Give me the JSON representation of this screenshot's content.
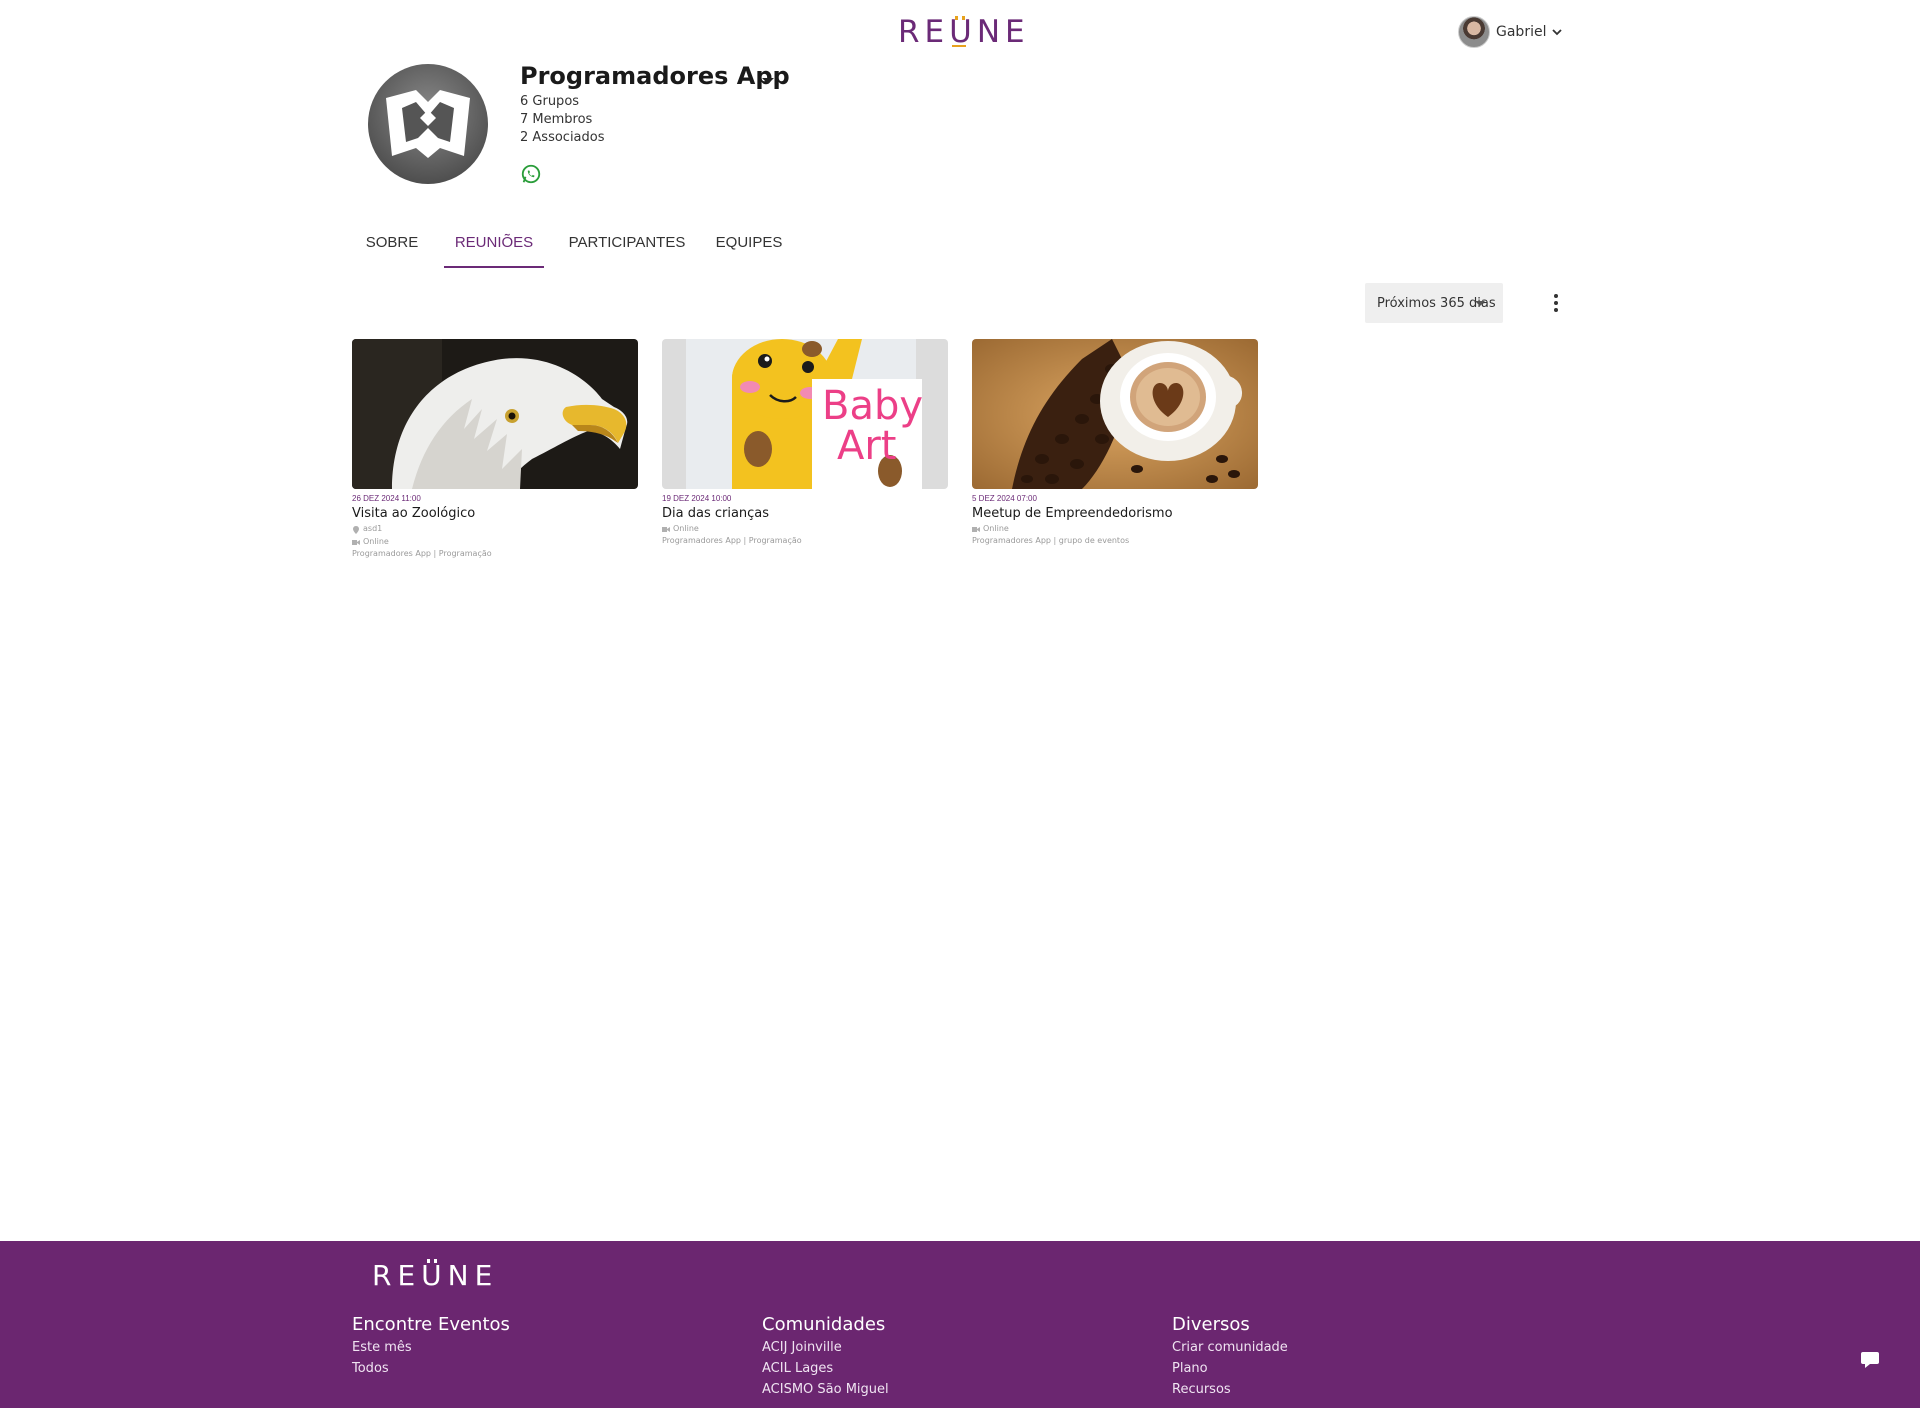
{
  "header": {
    "logo_text": "REUNE",
    "user_name": "Gabriel"
  },
  "community": {
    "name": "Programadores App",
    "stats": [
      "6 Grupos",
      "7 Membros",
      "2 Associados"
    ]
  },
  "tabs": [
    {
      "label": "SOBRE",
      "active": false
    },
    {
      "label": "REUNIÕES",
      "active": true
    },
    {
      "label": "PARTICIPANTES",
      "active": false
    },
    {
      "label": "EQUIPES",
      "active": false
    }
  ],
  "filter": {
    "selected": "Próximos 365 dias"
  },
  "events": [
    {
      "image": "eagle",
      "date": "26 DEZ 2024 11:00",
      "title": "Visita ao Zoológico",
      "location": "asd1",
      "mode": "Online",
      "group": "Programadores App | Programação"
    },
    {
      "image": "giraffe-baby-art",
      "image_text_1": "Baby",
      "image_text_2": "Art",
      "date": "19 DEZ 2024 10:00",
      "title": "Dia das crianças",
      "mode": "Online",
      "group": "Programadores App | Programação"
    },
    {
      "image": "coffee",
      "date": "5 DEZ 2024 07:00",
      "title": "Meetup de Empreendedorismo",
      "mode": "Online",
      "group": "Programadores App | grupo de eventos"
    }
  ],
  "footer": {
    "logo_text": "REUNE",
    "columns": [
      {
        "title": "Encontre Eventos",
        "links": [
          "Este mês",
          "Todos"
        ]
      },
      {
        "title": "Comunidades",
        "links": [
          "ACIJ Joinville",
          "ACIL Lages",
          "ACISMO São Miguel"
        ]
      },
      {
        "title": "Diversos",
        "links": [
          "Criar comunidade",
          "Plano",
          "Recursos"
        ]
      }
    ]
  },
  "colors": {
    "brand": "#6b2a77",
    "footer_bg": "#6b2670",
    "accent": "#e8a21e",
    "whatsapp": "#2a9d3a"
  }
}
